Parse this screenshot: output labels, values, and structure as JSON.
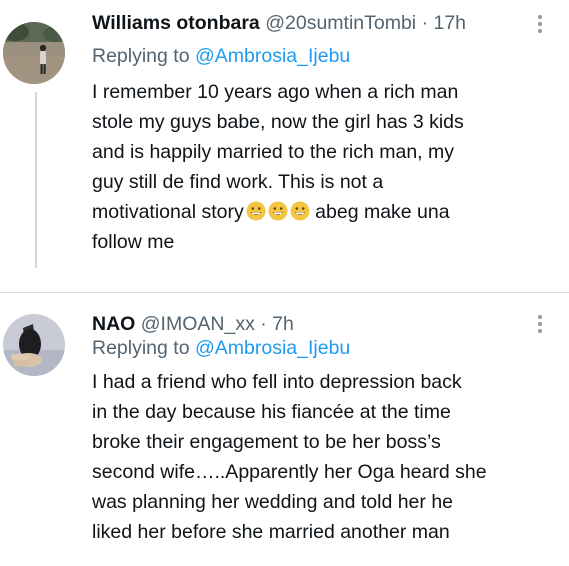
{
  "tweets": [
    {
      "author_name": "Williams otonbara",
      "handle": "@20sumtinTombi",
      "separator": "·",
      "time": "17h",
      "replying_prefix": "Replying to",
      "replying_to": "@Ambrosia_Ijebu",
      "body_lines": [
        "I remember 10 years ago when a rich man",
        "stole my guys babe, now the girl has 3 kids",
        "and is happily married to the rich man, my",
        "guy still de find work. This is not a",
        "motivational story",
        "abeg make una",
        "follow me"
      ],
      "emoji_count": 3
    },
    {
      "author_name": "NAO",
      "handle": "@IMOAN_xx",
      "separator": "·",
      "time": "7h",
      "replying_prefix": "Replying to",
      "replying_to": "@Ambrosia_Ijebu",
      "body_lines": [
        "I had a friend who fell into depression back",
        "in the day because his fiancée at the time",
        "broke their engagement to be her boss’s",
        "second wife…..Apparently her Oga heard she",
        "was planning her wedding and told her he",
        "liked her before she married another man"
      ]
    }
  ],
  "colors": {
    "text": "#0f1419",
    "secondary": "#536471",
    "link": "#1d9bf0",
    "divider": "#d9dde0",
    "thread_line": "#cfd9de",
    "emoji": "#f4c542"
  },
  "icons": {
    "more": "more-vertical-icon",
    "emoji": "grinning-face-icon"
  }
}
